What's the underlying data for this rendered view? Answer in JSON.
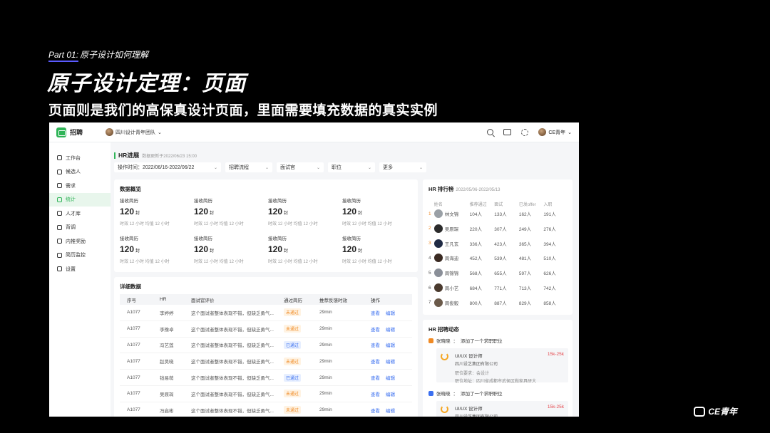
{
  "slide": {
    "kicker_part": "Part 01:",
    "kicker_text": "原子设计如何理解",
    "title": "原子设计定理：页面",
    "subtitle": "页面则是我们的高保真设计页面，里面需要填充数据的真实实例",
    "brand": "CE青年"
  },
  "app": {
    "name": "招聘",
    "team": "四川设计青年团队",
    "user": "CE青年",
    "sidebar": [
      {
        "label": "工作台",
        "icon": "workbench-icon"
      },
      {
        "label": "候选人",
        "icon": "candidate-icon"
      },
      {
        "label": "需求",
        "icon": "demand-icon"
      },
      {
        "label": "统计",
        "icon": "stats-icon",
        "active": true
      },
      {
        "label": "人才库",
        "icon": "talent-pool-icon"
      },
      {
        "label": "背调",
        "icon": "background-check-icon"
      },
      {
        "label": "内推奖励",
        "icon": "referral-reward-icon"
      },
      {
        "label": "简历监控",
        "icon": "resume-monitor-icon"
      },
      {
        "label": "设置",
        "icon": "settings-icon"
      }
    ],
    "page_title": "HR进展",
    "page_update": "数据更新于2022/06/23 15:00",
    "filters": [
      {
        "label": "操作时间：2022/06/16-2022/06/22"
      },
      {
        "label": "招聘流程"
      },
      {
        "label": "面试官"
      },
      {
        "label": "职位"
      },
      {
        "label": "更多"
      }
    ],
    "overview": {
      "title": "数据概览",
      "metric_label": "接收简历",
      "metric_value": "120",
      "metric_unit": "封",
      "metric_foot": "时效 12 小时  均值 12 小时"
    },
    "detail": {
      "title": "详细数据",
      "columns": [
        "序号",
        "HR",
        "面试官评价",
        "通过简历",
        "推荐反馈时效",
        "操作"
      ],
      "rows": [
        {
          "id": "A1077",
          "hr": "李婷婷",
          "review": "这个面试者整体表现不错，但缺乏勇气...",
          "status": "未通过",
          "status_type": "warn",
          "time": "29min"
        },
        {
          "id": "A1077",
          "hr": "李豫卓",
          "review": "这个面试者整体表现不错，但缺乏勇气...",
          "status": "未通过",
          "status_type": "warn",
          "time": "29min"
        },
        {
          "id": "A1077",
          "hr": "冯艺莲",
          "review": "这个面试者整体表现不错，但缺乏勇气...",
          "status": "已通过",
          "status_type": "ok",
          "time": "29min"
        },
        {
          "id": "A1077",
          "hr": "赵昊晓",
          "review": "这个面试者整体表现不错，但缺乏勇气...",
          "status": "未通过",
          "status_type": "warn",
          "time": "29min"
        },
        {
          "id": "A1077",
          "hr": "钱易萌",
          "review": "这个面试者整体表现不错，但缺乏勇气...",
          "status": "已通过",
          "status_type": "ok",
          "time": "29min"
        },
        {
          "id": "A1077",
          "hr": "吴原琛",
          "review": "这个面试者整体表现不错，但缺乏勇气...",
          "status": "未通过",
          "status_type": "warn",
          "time": "29min"
        },
        {
          "id": "A1077",
          "hr": "冯启彬",
          "review": "这个面试者整体表现不错，但缺乏勇气...",
          "status": "未通过",
          "status_type": "warn",
          "time": "29min"
        }
      ],
      "action_view": "查看",
      "action_edit": "编辑"
    },
    "rank": {
      "title": "HR 排行榜",
      "range": "2022/05/06-2022/05/13",
      "columns": [
        "姓名",
        "推荐通过",
        "面试",
        "已发offer",
        "入职"
      ],
      "rows": [
        {
          "n": "1",
          "name": "林文锦",
          "a": "104人",
          "b": "133人",
          "c": "162人",
          "d": "191人"
        },
        {
          "n": "2",
          "name": "吴原琛",
          "a": "220人",
          "b": "307人",
          "c": "249人",
          "d": "276人"
        },
        {
          "n": "3",
          "name": "王凡玄",
          "a": "336人",
          "b": "423人",
          "c": "365人",
          "d": "394人"
        },
        {
          "n": "4",
          "name": "周海迪",
          "a": "452人",
          "b": "539人",
          "c": "481人",
          "d": "510人"
        },
        {
          "n": "5",
          "name": "周锦锦",
          "a": "568人",
          "b": "655人",
          "c": "597人",
          "d": "626人"
        },
        {
          "n": "6",
          "name": "周小艺",
          "a": "684人",
          "b": "771人",
          "c": "713人",
          "d": "742人"
        },
        {
          "n": "7",
          "name": "周俊毅",
          "a": "800人",
          "b": "887人",
          "c": "829人",
          "d": "858人"
        }
      ]
    },
    "feed": {
      "title": "HR 招聘动态",
      "items": [
        {
          "who": "张晓晓",
          "action": "添加了一个求职职位",
          "job": "UI/UX 设计师",
          "company": "四川设艺集团有限公司",
          "salary": "15k-25k",
          "req": "职位要求：会设计",
          "addr": "职位地址：四川省成都市武侯区鞋家具研大",
          "color": "#f08a24"
        },
        {
          "who": "张晓晓",
          "action": "添加了一个求职职位",
          "job": "UI/UX 设计师",
          "company": "四川设艺集团有限公司",
          "salary": "15k-25k",
          "req": "",
          "addr": "",
          "color": "#3a6ff0"
        }
      ]
    }
  }
}
